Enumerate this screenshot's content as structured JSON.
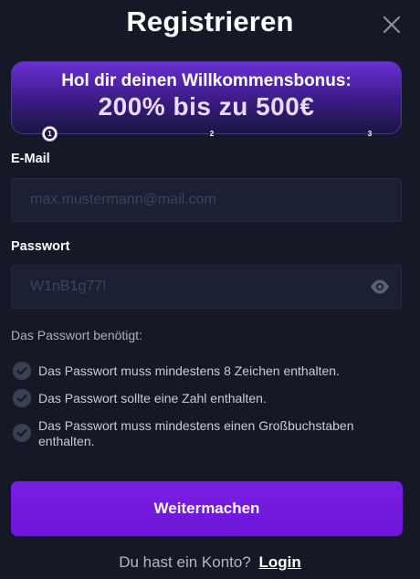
{
  "modal": {
    "title": "Registrieren"
  },
  "banner": {
    "line1": "Hol dir deinen Willkommensbonus:",
    "line2": "200% bis zu 500€",
    "steps": [
      "1",
      "2",
      "3"
    ],
    "active_step": 1
  },
  "form": {
    "email": {
      "label": "E-Mail",
      "placeholder": "max.mustermann@mail.com",
      "value": ""
    },
    "password": {
      "label": "Passwort",
      "placeholder": "W1nB1g77!",
      "value": ""
    }
  },
  "requirements": {
    "title": "Das Passwort benötigt:",
    "items": [
      "Das Passwort muss mindestens 8 Zeichen enthalten.",
      "Das Passwort sollte eine Zahl enthalten.",
      "Das Passwort muss mindestens einen Großbuchstaben enthalten."
    ]
  },
  "actions": {
    "continue_label": "Weitermachen",
    "have_account_text": "Du hast ein Konto?",
    "login_label": "Login"
  },
  "icons": {
    "close": "close-icon",
    "eye": "eye-icon",
    "check": "check-circle-icon"
  },
  "colors": {
    "background": "#141827",
    "field_background": "#1b2132",
    "accent": "#7a1ee6",
    "check_circle": "#3a4152"
  }
}
